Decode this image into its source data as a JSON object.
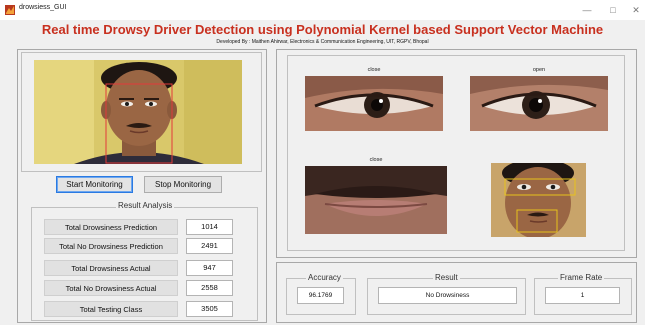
{
  "window": {
    "title": "drowsiess_GUI",
    "minimize": "—",
    "maximize": "□",
    "close": "✕"
  },
  "header": {
    "title": "Real time Drowsy Driver Detection using Polynomial Kernel based Support Vector Machine",
    "subtitle": "Developed By : Maithen Ahirwar, Electronics & Communication Engineering, UIT, RGPV, Bhopal"
  },
  "controls": {
    "start_label": "Start Monitoring",
    "stop_label": "Stop Monitoring"
  },
  "analysis": {
    "title": "Result Analysis",
    "rows": [
      {
        "label": "Total Drowsiness Prediction",
        "value": "1014"
      },
      {
        "label": "Total No Drowsiness Prediction",
        "value": "2491"
      },
      {
        "label": "Total Drowsiness Actual",
        "value": "947"
      },
      {
        "label": "Total No Drowsiness Actual",
        "value": "2558"
      },
      {
        "label": "Total Testing Class",
        "value": "3505"
      }
    ]
  },
  "images": {
    "left_eye_label": "close",
    "right_eye_label": "open",
    "mouth_label": "close"
  },
  "results": {
    "accuracy_title": "Accuracy",
    "accuracy_value": "96.1769",
    "result_title": "Result",
    "result_value": "No Drowsiness",
    "frame_rate_title": "Frame Rate",
    "frame_rate_value": "1"
  },
  "colors": {
    "title_red": "#c8301f",
    "detect_red": "#e23a3a",
    "detect_yellow": "#e7c21c",
    "active_button_blue": "#2a7ae2"
  }
}
